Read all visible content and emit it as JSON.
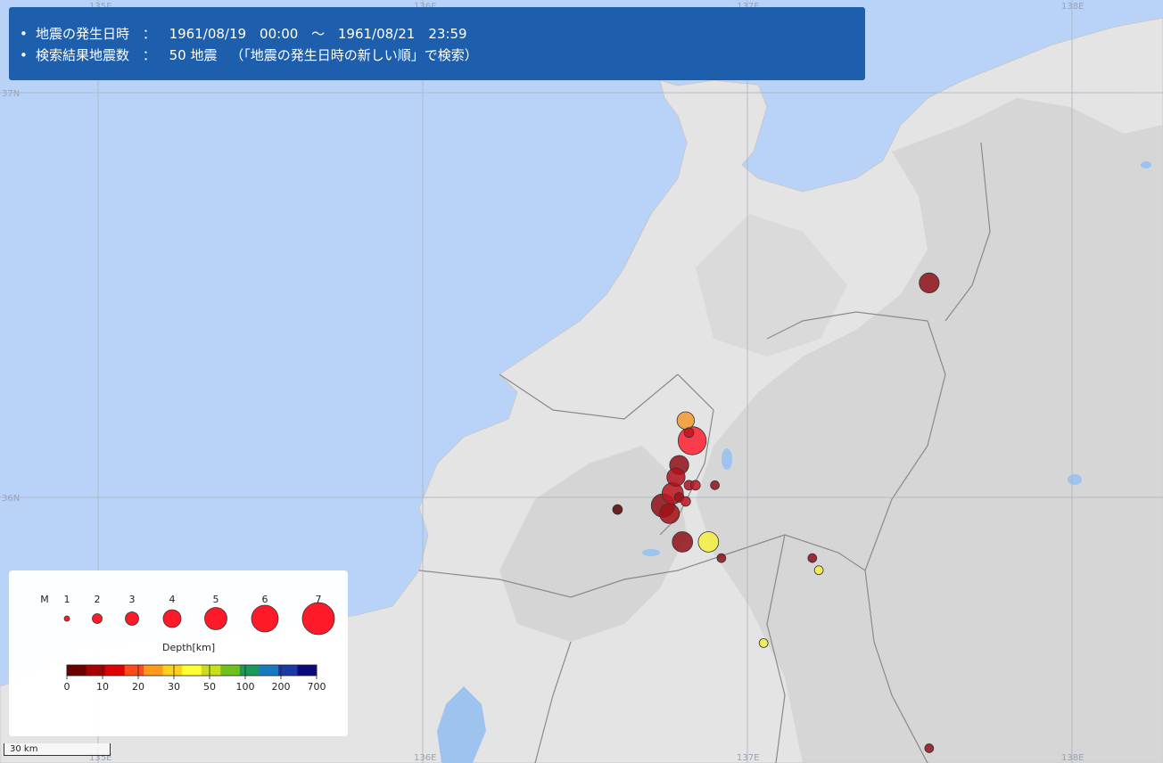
{
  "info": {
    "line1_label": "地震の発生日時",
    "colon": "：",
    "start": "1961/08/19　00:00",
    "tilde": "～",
    "end": "1961/08/21　23:59",
    "line2_label": "検索結果地震数",
    "count": "50 地震",
    "note": "（「地震の発生日時の新しい順」で検索）"
  },
  "grid": {
    "lon_labels": [
      "135E",
      "136E",
      "137E",
      "138E"
    ],
    "lat_labels": [
      "37N",
      "36N"
    ]
  },
  "legend": {
    "m_label": "M",
    "magnitudes": [
      "1",
      "2",
      "3",
      "4",
      "5",
      "6",
      "7"
    ],
    "depth_title": "Depth[km]",
    "depth_ticks": [
      "0",
      "10",
      "20",
      "30",
      "50",
      "100",
      "200",
      "700"
    ],
    "depth_colors": [
      "#6b0000",
      "#a80000",
      "#e00000",
      "#ff4a1a",
      "#ff9a1a",
      "#ffd21a",
      "#ffff33",
      "#c8e01a",
      "#6ec01a",
      "#1a9a5a",
      "#1a7abf",
      "#1a3aa8",
      "#0a0a7a"
    ]
  },
  "scale": {
    "label": "30 km"
  },
  "colors": {
    "sea": "#b8d3f7",
    "land": "#e4e4e4",
    "header_bg": "#1e5fad"
  },
  "quakes": [
    {
      "lon": 136.83,
      "lat": 36.14,
      "mag": 6.1,
      "depth": 10,
      "color": "#ff2030"
    },
    {
      "lon": 136.81,
      "lat": 36.19,
      "mag": 3.6,
      "depth": 20,
      "color": "#f39a30"
    },
    {
      "lon": 136.79,
      "lat": 36.08,
      "mag": 4.0,
      "depth": 2,
      "color": "#901018"
    },
    {
      "lon": 136.78,
      "lat": 36.05,
      "mag": 3.8,
      "depth": 5,
      "color": "#b0101c"
    },
    {
      "lon": 136.77,
      "lat": 36.01,
      "mag": 4.5,
      "depth": 5,
      "color": "#c01420"
    },
    {
      "lon": 136.74,
      "lat": 35.98,
      "mag": 5.0,
      "depth": 2,
      "color": "#901018"
    },
    {
      "lon": 136.76,
      "lat": 35.96,
      "mag": 4.2,
      "depth": 3,
      "color": "#a01018"
    },
    {
      "lon": 136.8,
      "lat": 35.89,
      "mag": 4.3,
      "depth": 3,
      "color": "#901018"
    },
    {
      "lon": 136.88,
      "lat": 35.89,
      "mag": 4.3,
      "depth": 28,
      "color": "#f5f040"
    },
    {
      "lon": 136.82,
      "lat": 36.03,
      "mag": 1.8,
      "depth": 5,
      "color": "#b01020"
    },
    {
      "lon": 136.84,
      "lat": 36.03,
      "mag": 1.8,
      "depth": 5,
      "color": "#c01420"
    },
    {
      "lon": 136.79,
      "lat": 36.0,
      "mag": 1.8,
      "depth": 5,
      "color": "#a01018"
    },
    {
      "lon": 136.81,
      "lat": 35.99,
      "mag": 1.8,
      "depth": 5,
      "color": "#c01420"
    },
    {
      "lon": 136.82,
      "lat": 36.16,
      "mag": 1.8,
      "depth": 5,
      "color": "#c01420"
    },
    {
      "lon": 136.9,
      "lat": 36.03,
      "mag": 1.6,
      "depth": 3,
      "color": "#901018"
    },
    {
      "lon": 136.6,
      "lat": 35.97,
      "mag": 1.8,
      "depth": 0,
      "color": "#5a0000"
    },
    {
      "lon": 136.92,
      "lat": 35.85,
      "mag": 1.6,
      "depth": 3,
      "color": "#901018"
    },
    {
      "lon": 137.2,
      "lat": 35.85,
      "mag": 1.6,
      "depth": 3,
      "color": "#901018"
    },
    {
      "lon": 137.22,
      "lat": 35.82,
      "mag": 1.6,
      "depth": 28,
      "color": "#f5f040"
    },
    {
      "lon": 137.05,
      "lat": 35.64,
      "mag": 1.6,
      "depth": 28,
      "color": "#f5f040"
    },
    {
      "lon": 137.56,
      "lat": 36.53,
      "mag": 4.2,
      "depth": 3,
      "color": "#901018"
    },
    {
      "lon": 137.56,
      "lat": 35.38,
      "mag": 1.6,
      "depth": 3,
      "color": "#901018"
    }
  ]
}
